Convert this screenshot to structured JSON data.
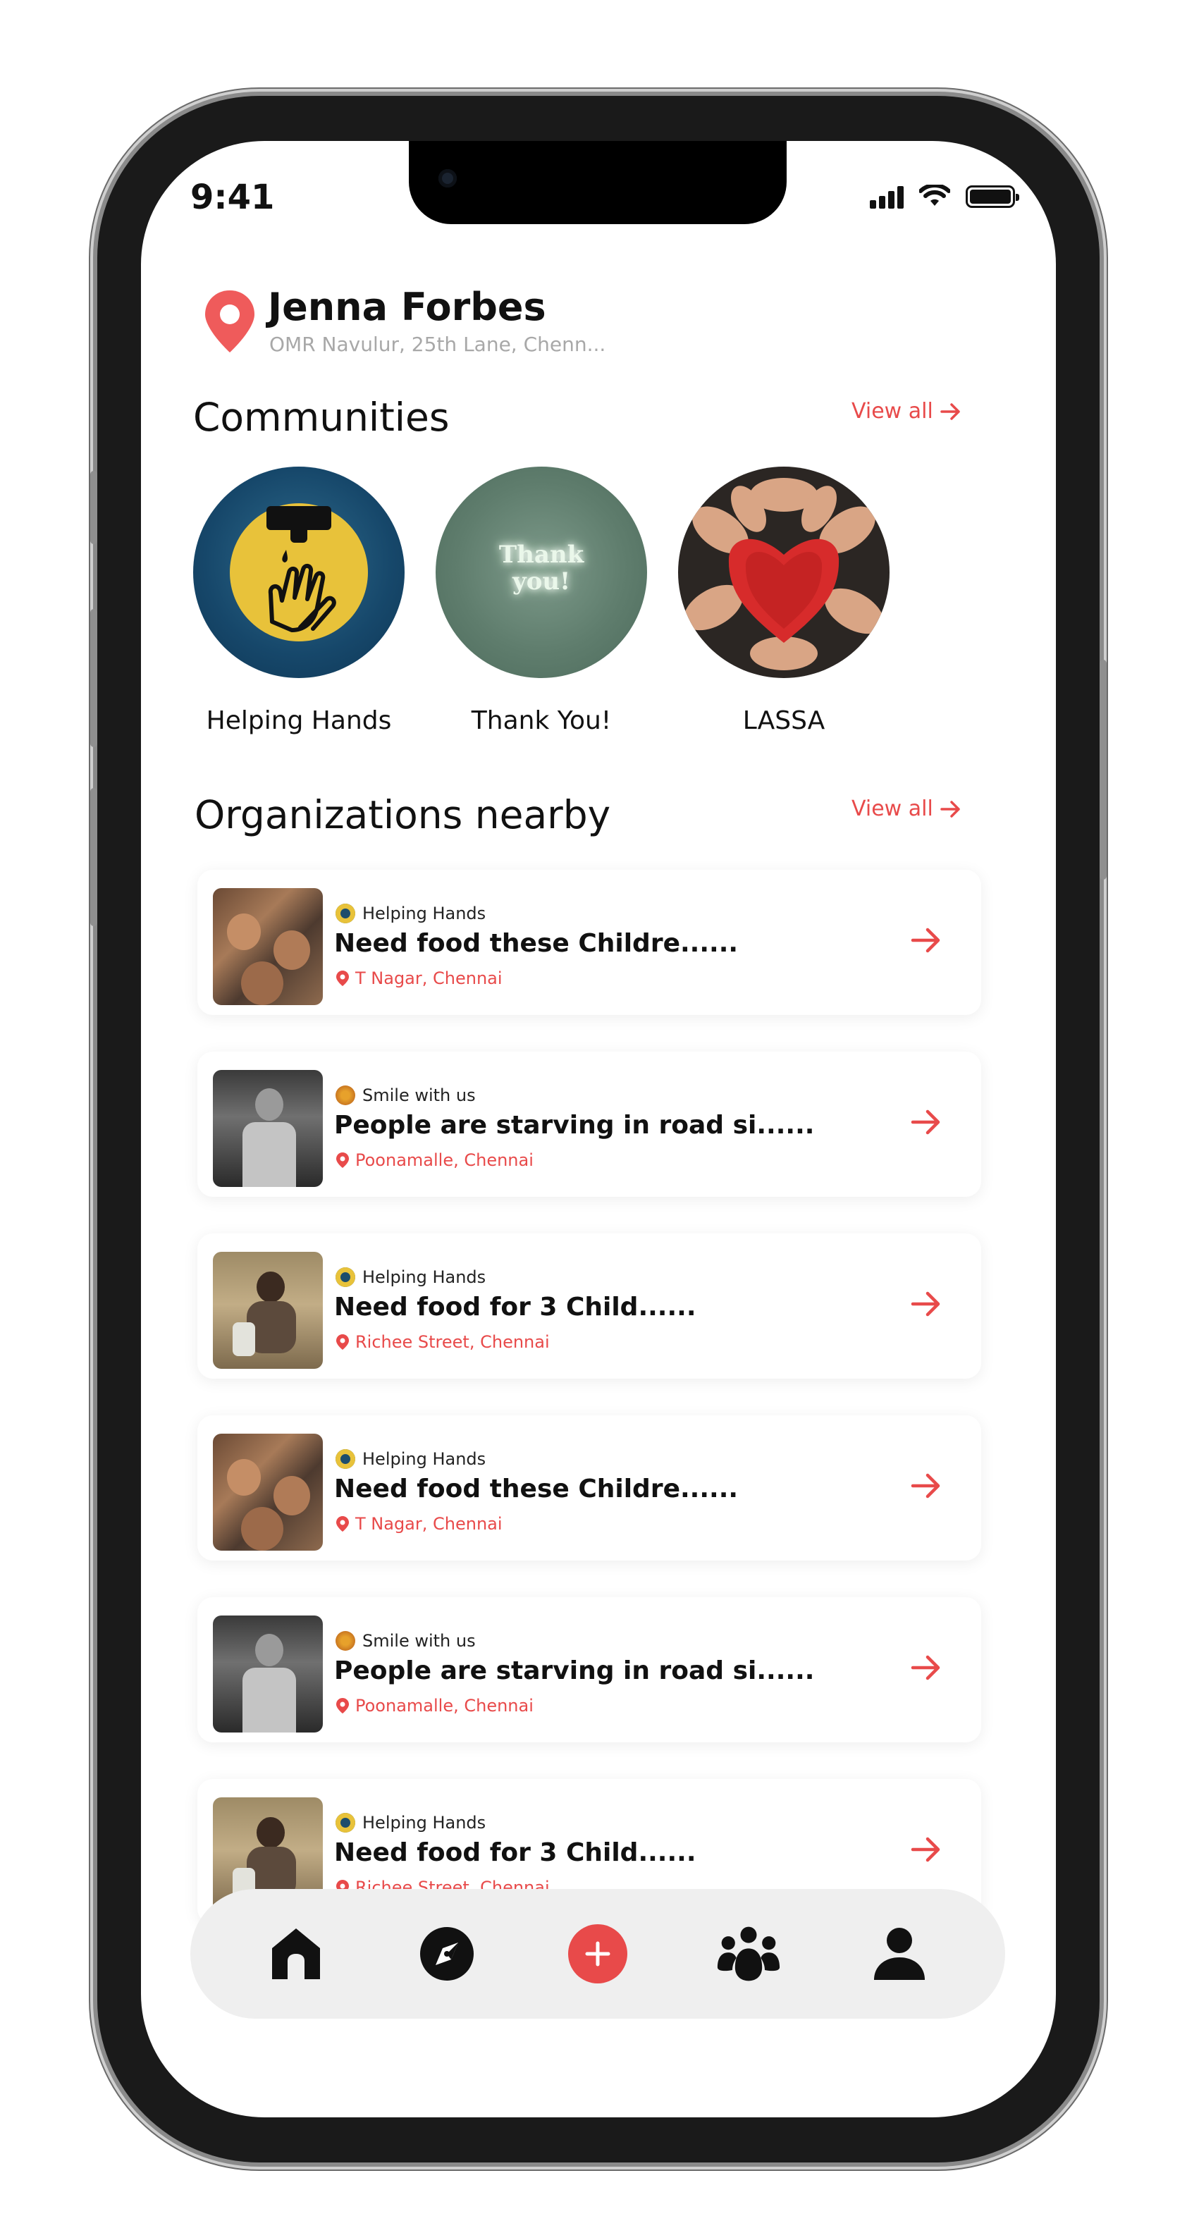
{
  "status_bar": {
    "time": "9:41"
  },
  "header": {
    "name": "Jenna Forbes",
    "address": "OMR Navulur, 25th Lane, Chenn..."
  },
  "communities": {
    "title": "Communities",
    "view_all": "View all",
    "items": [
      {
        "label": "Helping Hands"
      },
      {
        "label": "Thank You!",
        "image_text": "Thank you!"
      },
      {
        "label": "LASSA"
      }
    ]
  },
  "organizations": {
    "title": "Organizations nearby",
    "view_all": "View all",
    "items": [
      {
        "org": "Helping Hands",
        "title": "Need food these Childre......",
        "location": "T Nagar, Chennai"
      },
      {
        "org": "Smile with us",
        "title": "People are starving in road si......",
        "location": "Poonamalle, Chennai"
      },
      {
        "org": "Helping Hands",
        "title": "Need food for 3 Child......",
        "location": "Richee Street, Chennai"
      },
      {
        "org": "Helping Hands",
        "title": "Need food these Childre......",
        "location": "T Nagar, Chennai"
      },
      {
        "org": "Smile with us",
        "title": "People are starving in road si......",
        "location": "Poonamalle, Chennai"
      },
      {
        "org": "Helping Hands",
        "title": "Need food for 3 Child......",
        "location": "Richee Street, Chennai"
      }
    ]
  },
  "bottom_nav": {
    "items": [
      "home-icon",
      "compass-icon",
      "add-icon",
      "community-icon",
      "profile-icon"
    ],
    "active": "home-icon"
  },
  "colors": {
    "accent": "#e84a4a",
    "nav_bg": "#efefef"
  }
}
